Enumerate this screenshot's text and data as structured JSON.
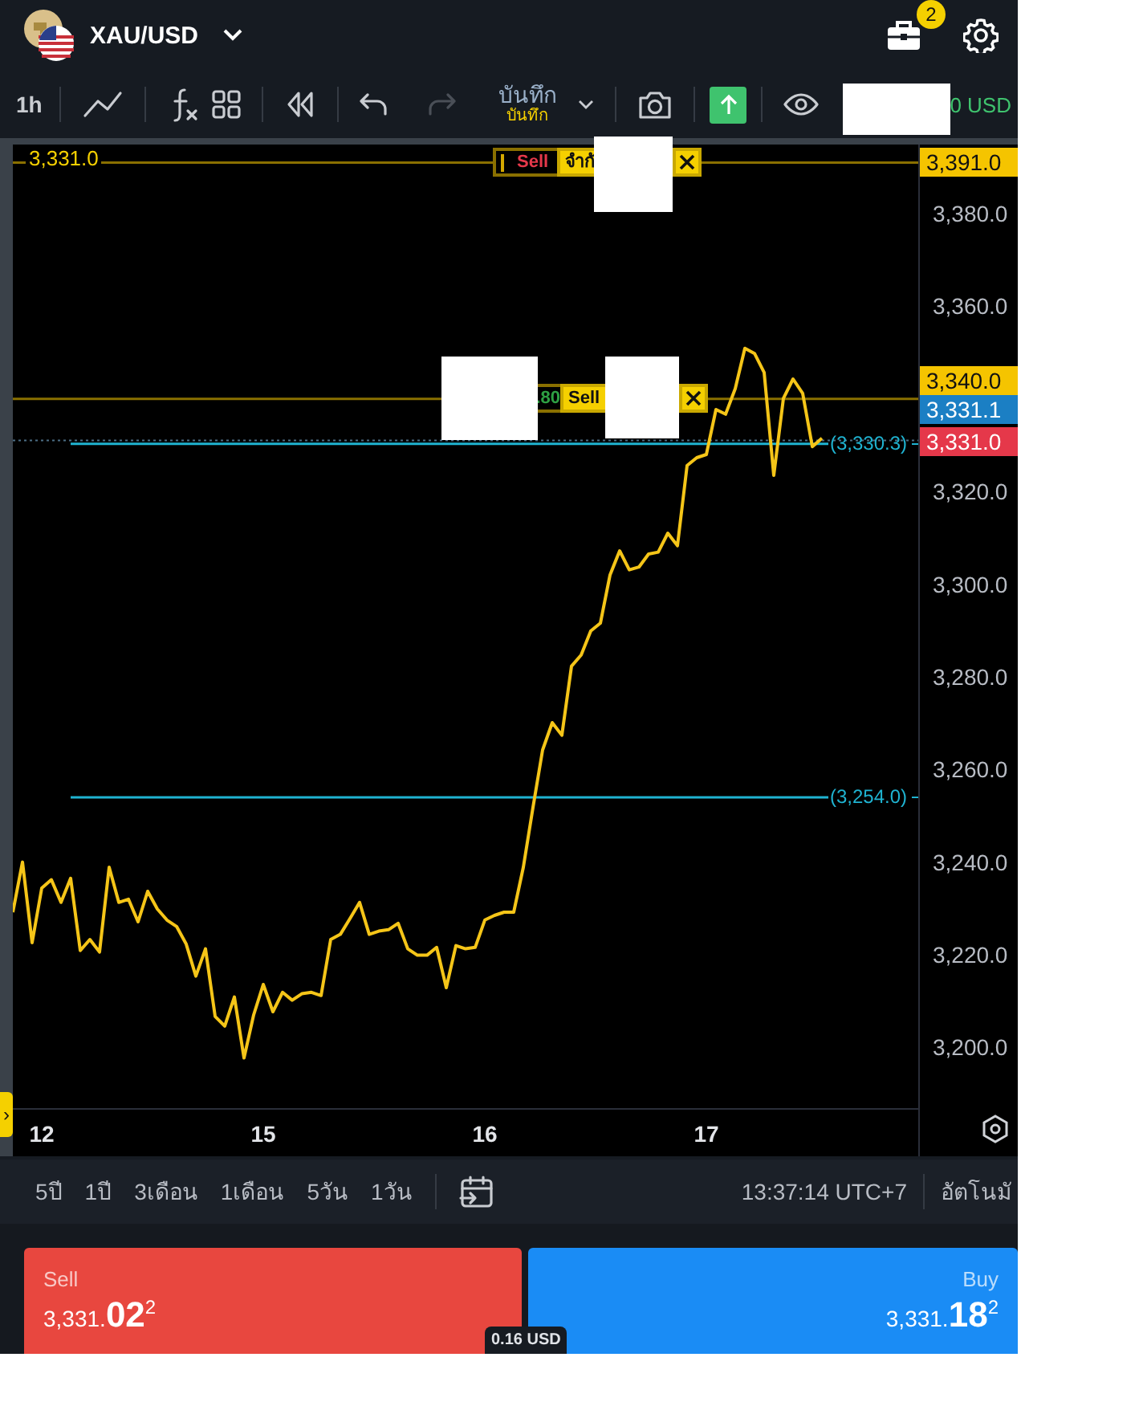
{
  "header": {
    "symbol": "XAU/USD",
    "notifications": "2"
  },
  "toolbar": {
    "interval": "1h",
    "template_label": "บันทึก",
    "template_sublabel": "บันทึก",
    "redo_disabled": true,
    "balance": "0 USD"
  },
  "chart": {
    "collapse_handle": "›",
    "chart_data": {
      "type": "line",
      "ylim": [
        3186.9,
        3394.9
      ],
      "categories": [
        null,
        null,
        null,
        "12",
        null,
        null,
        null,
        null,
        null,
        null,
        null,
        null,
        null,
        null,
        null,
        null,
        null,
        null,
        null,
        null,
        null,
        null,
        null,
        null,
        null,
        null,
        "15",
        null,
        null,
        null,
        null,
        null,
        null,
        null,
        null,
        null,
        null,
        null,
        null,
        null,
        null,
        null,
        null,
        null,
        null,
        null,
        null,
        null,
        null,
        "16",
        null,
        null,
        null,
        null,
        null,
        null,
        null,
        null,
        null,
        null,
        null,
        null,
        null,
        null,
        null,
        null,
        null,
        null,
        null,
        null,
        null,
        null,
        "17",
        null,
        null,
        null,
        null,
        null,
        null,
        null,
        null,
        null,
        null,
        null,
        null
      ],
      "yticks": [
        {
          "value": 3200,
          "label": "3,200.0"
        },
        {
          "value": 3220,
          "label": "3,220.0"
        },
        {
          "value": 3240,
          "label": "3,240.0"
        },
        {
          "value": 3260,
          "label": "3,260.0"
        },
        {
          "value": 3280,
          "label": "3,280.0"
        },
        {
          "value": 3300,
          "label": "3,300.0"
        },
        {
          "value": 3320,
          "label": "3,320.0"
        },
        {
          "value": 3360,
          "label": "3,360.0"
        },
        {
          "value": 3380,
          "label": "3,380.0"
        }
      ],
      "ref_lines": [
        {
          "axis": "y",
          "value": 3391,
          "color": "#8a7000"
        },
        {
          "axis": "y",
          "value": 3340,
          "color": "#8a7000"
        },
        {
          "axis": "y",
          "value": 3331.02,
          "color": "#4d6f86"
        },
        {
          "axis": "y",
          "value": 3330.3,
          "color": "#1fb3d1"
        },
        {
          "axis": "y",
          "value": 3254,
          "color": "#1fb3d1"
        }
      ],
      "series": [
        {
          "color": "#f5c518",
          "values": [
            3229.2,
            3240.0,
            3222.6,
            3234.4,
            3236.2,
            3231.3,
            3236.5,
            3220.9,
            3223.3,
            3220.6,
            3238.9,
            3231.3,
            3232.0,
            3227.1,
            3233.7,
            3229.9,
            3227.5,
            3226.1,
            3222.3,
            3215.4,
            3221.3,
            3206.7,
            3204.6,
            3210.9,
            3197.7,
            3207.0,
            3213.6,
            3207.7,
            3211.9,
            3210.2,
            3211.6,
            3211.9,
            3211.2,
            3223.3,
            3224.4,
            3227.8,
            3231.3,
            3224.4,
            3225.1,
            3225.4,
            3226.8,
            3221.3,
            3219.9,
            3219.9,
            3221.6,
            3212.9,
            3222.0,
            3221.3,
            3221.6,
            3227.5,
            3228.5,
            3229.2,
            3229.2,
            3238.9,
            3251.8,
            3264.2,
            3270.1,
            3267.4,
            3282.3,
            3284.7,
            3289.9,
            3291.6,
            3302.0,
            3307.2,
            3303.1,
            3303.7,
            3306.5,
            3306.9,
            3311.0,
            3308.3,
            3325.6,
            3327.3,
            3328.0,
            3337.7,
            3336.7,
            3342.2,
            3350.9,
            3349.8,
            3345.7,
            3323.5,
            3340.1,
            3344.3,
            3341.2,
            3329.7,
            3331.5
          ]
        }
      ]
    },
    "overlays": [
      {
        "kind": "line_label",
        "text": "3,331.0"
      },
      {
        "kind": "order",
        "side": "Sell",
        "text": "จำกั"
      },
      {
        "kind": "tag",
        "text": "3,391.0",
        "color": "#f5c400"
      },
      {
        "kind": "order",
        "pnl": ".80",
        "side": "Sell"
      },
      {
        "kind": "tag",
        "text": "3,340.0",
        "color": "#f5c400"
      },
      {
        "kind": "tag",
        "text": "3,331.1",
        "color": "#1b7fc4"
      },
      {
        "kind": "price_line"
      },
      {
        "kind": "level",
        "text": "(3,330.3)"
      },
      {
        "kind": "tag",
        "text": "3,331.0",
        "color": "#e5384a"
      },
      {
        "kind": "level",
        "text": "(3,254.0)"
      }
    ]
  },
  "timeframes": [
    {
      "label": "5ปี",
      "selected": false
    },
    {
      "label": "1ปี",
      "selected": false
    },
    {
      "label": "3เดือน",
      "selected": false
    },
    {
      "label": "1เดือน",
      "selected": false
    },
    {
      "label": "5วัน",
      "selected": false
    },
    {
      "label": "1วัน",
      "selected": false
    }
  ],
  "clock": "13:37:14 UTC+7",
  "scale_mode": "อัตโนมั",
  "trade": {
    "sell": {
      "label": "Sell",
      "price": "3,331.",
      "big": "02",
      "sup": "2"
    },
    "buy": {
      "label": "Buy",
      "price": "3,331.",
      "big": "18",
      "sup": "2"
    },
    "spread": "0.16 USD"
  }
}
